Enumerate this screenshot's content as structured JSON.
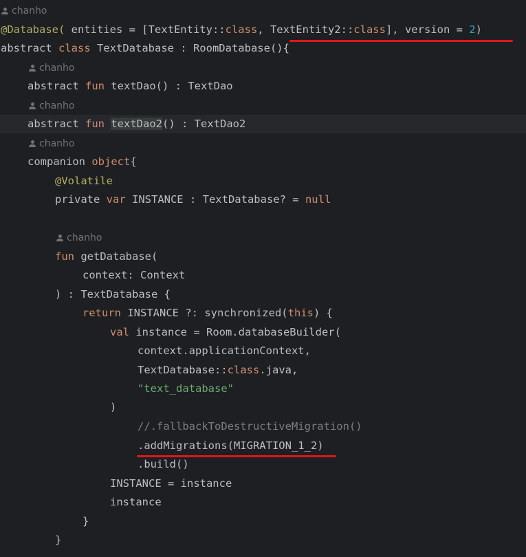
{
  "editor": {
    "language": "kotlin",
    "author": "chanho",
    "lines": {
      "a1_author": "chanho",
      "l1_ann": "@Database(",
      "l1_a": " entities = [TextEntity::",
      "l1_kw1": "class",
      "l1_b": ", TextEntity2::",
      "l1_kw2": "class",
      "l1_c": "], version = ",
      "l1_num": "2",
      "l1_d": ")",
      "l2_kw1": "abstract",
      "l2_sp": " ",
      "l2_kw2": "class",
      "l2_rest": " TextDatabase : RoomDatabase(){",
      "a2_author": "chanho",
      "l3_kw1": "abstract",
      "l3_sp": " ",
      "l3_kw2": "fun",
      "l3_rest": " textDao() : TextDao",
      "a3_author": "chanho",
      "l4_kw1": "abstract",
      "l4_sp": " ",
      "l4_kw2": "fun",
      "l4_sp2": " ",
      "l4_name": "textDao2",
      "l4_rest": "() : TextDao2",
      "a4_author": "chanho",
      "l5_a": "companion ",
      "l5_kw": "object",
      "l5_b": "{",
      "l6_ann": "@Volatile",
      "l7_a": "private ",
      "l7_kw": "var",
      "l7_b": " INSTANCE : TextDatabase? = ",
      "l7_kw2": "null",
      "a5_author": "chanho",
      "l8_kw": "fun",
      "l8_rest": " getDatabase(",
      "l9": "context: Context",
      "l10": ") : TextDatabase {",
      "l11_kw": "return",
      "l11_a": " INSTANCE ?: synchronized(",
      "l11_kw2": "this",
      "l11_b": ") {",
      "l12_kw": "val",
      "l12_rest": " instance = Room.databaseBuilder(",
      "l13": "context.applicationContext,",
      "l14_a": "TextDatabase::",
      "l14_kw": "class",
      "l14_b": ".java,",
      "l15_str": "\"text_database\"",
      "l16": ")",
      "l17_cmt": "//.fallbackToDestructiveMigration()",
      "l18": ".addMigrations(MIGRATION_1_2)",
      "l19": ".build()",
      "l20": "INSTANCE = instance",
      "l21": "instance",
      "l22": "}",
      "l23": "}"
    },
    "highlighted_symbol": "textDao2"
  },
  "annotations": {
    "underline_color": "#e0161b",
    "underlined": [
      "TextEntity2::class], version = 2)",
      ".addMigrations(MIGRATION_1_2)"
    ]
  }
}
